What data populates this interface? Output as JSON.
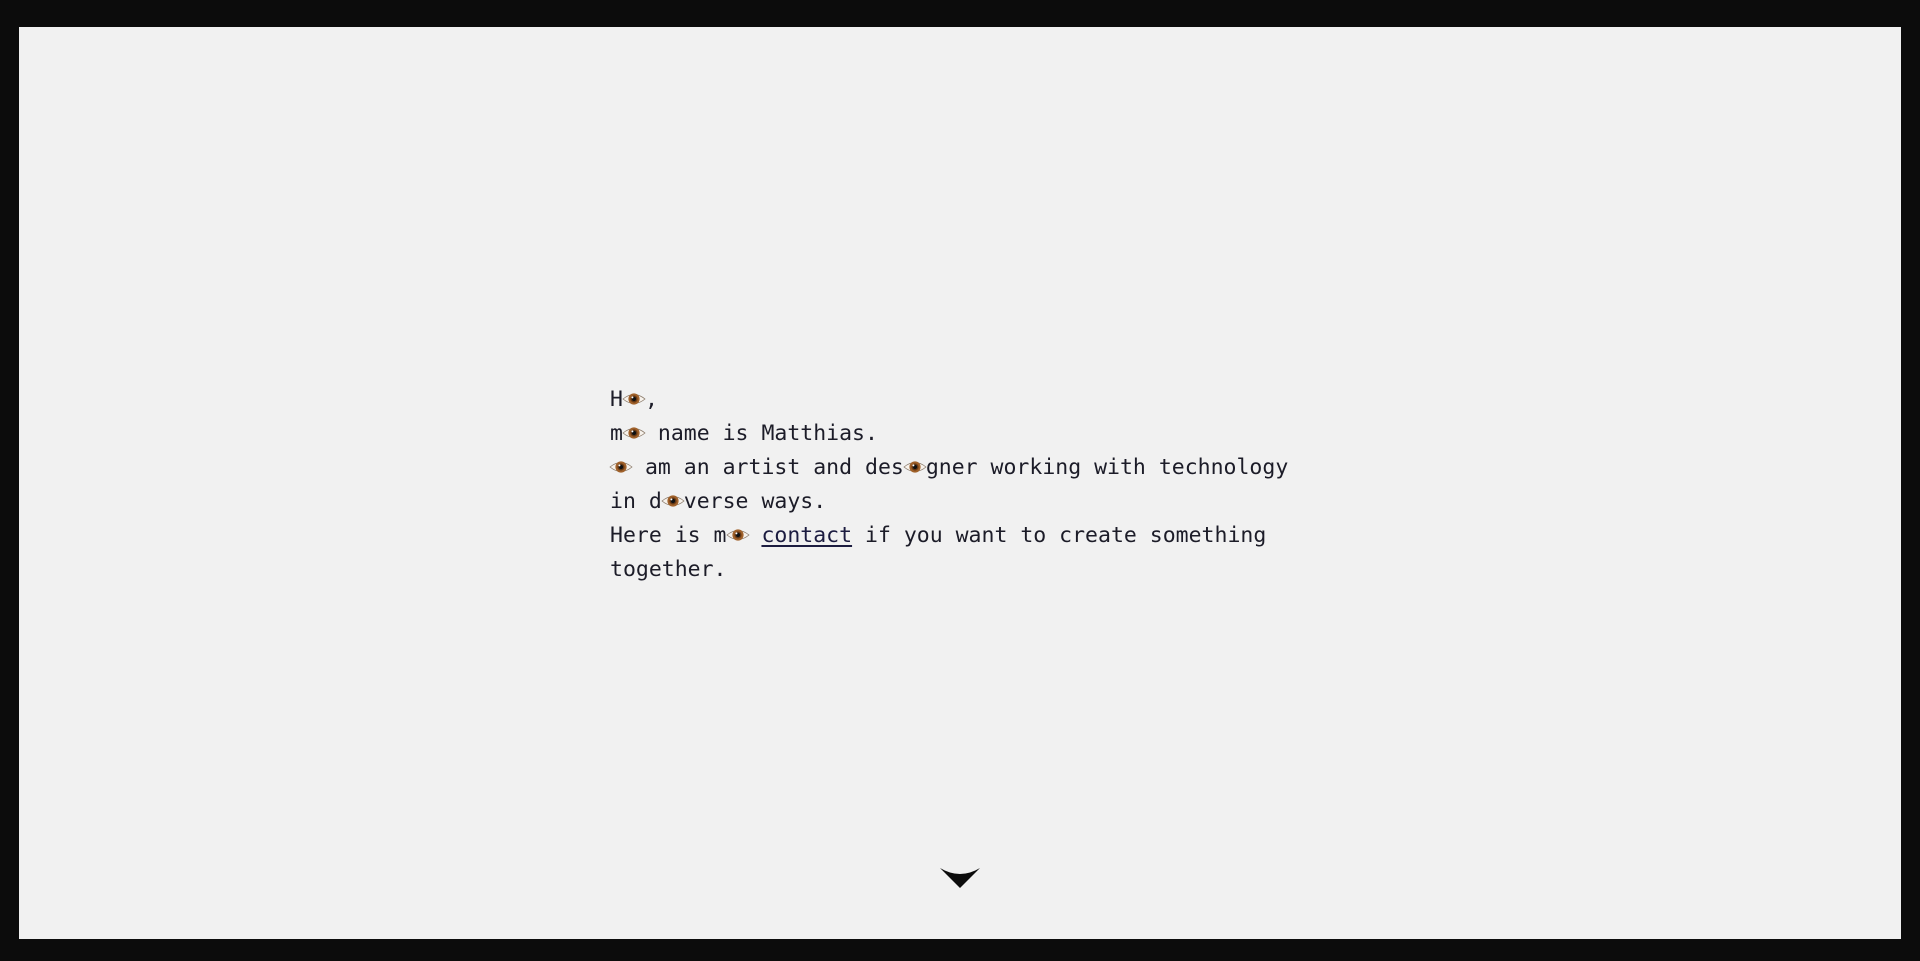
{
  "intro": {
    "line1": {
      "a": "H",
      "b": ","
    },
    "line2": {
      "a": "m",
      "b": " name is Matthias."
    },
    "line3": {
      "a": " am an artist and des",
      "b": "gner working with technology"
    },
    "line4": {
      "a": "in d",
      "b": "verse ways."
    },
    "line5": {
      "a": "Here is m",
      "b": " ",
      "link": "contact",
      "c": " if you want to create something"
    },
    "line6": {
      "a": "together."
    }
  },
  "icons": {
    "eye": "eye-icon",
    "scroll": "chevron-down-icon"
  },
  "colors": {
    "background": "#f1f1f1",
    "frame": "#0c0c0c",
    "text": "#1c1c28"
  }
}
